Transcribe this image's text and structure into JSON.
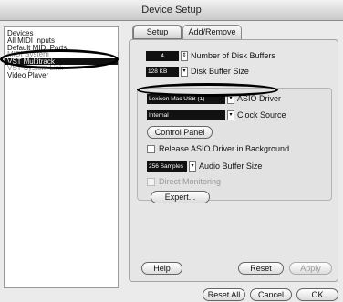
{
  "window": {
    "title": "Device Setup"
  },
  "sidebar": {
    "header": "Devices",
    "items": [
      {
        "label": "All MIDI Inputs"
      },
      {
        "label": "Default MIDI Ports"
      },
      {
        "label": "MIDI System"
      },
      {
        "label": "VST Multitrack"
      },
      {
        "label": "VST System Link"
      },
      {
        "label": "Video Player"
      }
    ]
  },
  "tabs": [
    {
      "label": "Setup"
    },
    {
      "label": "Add/Remove"
    }
  ],
  "setup": {
    "disk_buffers": {
      "value": "4",
      "label": "Number of Disk Buffers"
    },
    "disk_buffer_size": {
      "value": "128 KB",
      "label": "Disk Buffer Size"
    },
    "asio_driver": {
      "value": "Lexicon Mac USB (1)",
      "label": "ASIO Driver"
    },
    "clock_source": {
      "value": "Internal",
      "label": "Clock Source"
    },
    "control_panel_label": "Control Panel",
    "release_driver_label": "Release ASIO Driver in Background",
    "audio_buffer": {
      "value": "256 Samples",
      "label": "Audio Buffer Size"
    },
    "direct_monitoring_label": "Direct Monitoring",
    "expert_label": "Expert...",
    "help_label": "Help",
    "reset_label": "Reset",
    "apply_label": "Apply"
  },
  "footer": {
    "reset_all_label": "Reset All",
    "cancel_label": "Cancel",
    "ok_label": "OK"
  }
}
